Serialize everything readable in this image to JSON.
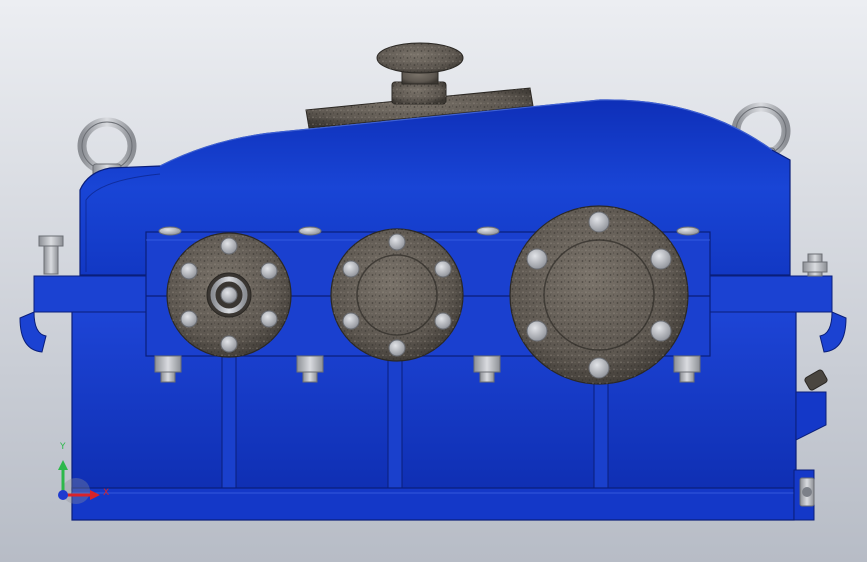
{
  "viewport": {
    "background_top": "#ECEEF2",
    "background_bottom": "#B7BCC6"
  },
  "model": {
    "body_color": "#1339C8",
    "body_dark": "#0C238C",
    "body_light": "#3A63E6",
    "metal_color": "#B9BCC2",
    "casting_color": "#6A645C",
    "casting_dark": "#3E3A35",
    "components": [
      "housing-lower",
      "housing-cover",
      "split-flange",
      "inspection-cover",
      "breather-cap",
      "lifting-eye-left",
      "lifting-eye-right",
      "bearing-cap-input",
      "bearing-cap-intermediate",
      "bearing-cap-output",
      "flange-bolts",
      "oil-drain-plug",
      "oil-level-indicator"
    ]
  },
  "triad": {
    "y_label": "Y",
    "x_label": "X",
    "y_color": "#2DB84B",
    "x_color": "#D8232A",
    "z_color": "#1E3ACF"
  }
}
